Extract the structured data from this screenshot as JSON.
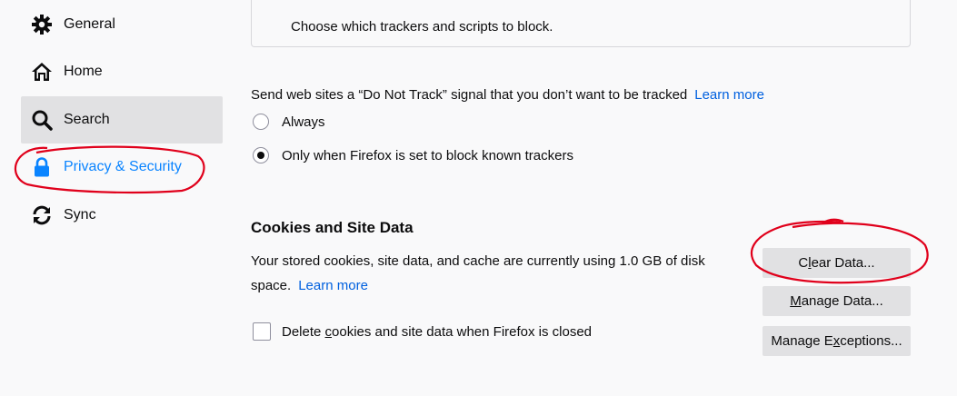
{
  "sidebar": {
    "items": [
      {
        "label": "General",
        "icon": "gear-icon"
      },
      {
        "label": "Home",
        "icon": "home-icon"
      },
      {
        "label": "Search",
        "icon": "search-icon"
      },
      {
        "label": "Privacy & Security",
        "icon": "lock-icon"
      },
      {
        "label": "Sync",
        "icon": "sync-icon"
      }
    ]
  },
  "main": {
    "tracker_box_text": "Choose which trackers and scripts to block.",
    "dnt": {
      "text": "Send web sites a “Do Not Track” signal that you don’t want to be tracked",
      "learn_more": "Learn more",
      "options": [
        {
          "label": "Always",
          "checked": false
        },
        {
          "label": "Only when Firefox is set to block known trackers",
          "checked": true
        }
      ]
    },
    "cookies": {
      "title": "Cookies and Site Data",
      "desc": "Your stored cookies, site data, and cache are currently using 1.0 GB of disk space.",
      "learn_more": "Learn more",
      "delete_on_close": {
        "pre": "Delete ",
        "access_key": "c",
        "post": "ookies and site data when Firefox is closed",
        "checked": false
      },
      "buttons": {
        "clear": {
          "pre": "C",
          "access_key": "l",
          "post": "ear Data..."
        },
        "manage": {
          "pre": "",
          "access_key": "M",
          "post": "anage Data..."
        },
        "exceptions": {
          "pre": "Manage E",
          "access_key": "x",
          "post": "ceptions..."
        }
      }
    }
  },
  "colors": {
    "accent": "#0a84ff",
    "link": "#0060df",
    "annotation": "#e0001b"
  }
}
